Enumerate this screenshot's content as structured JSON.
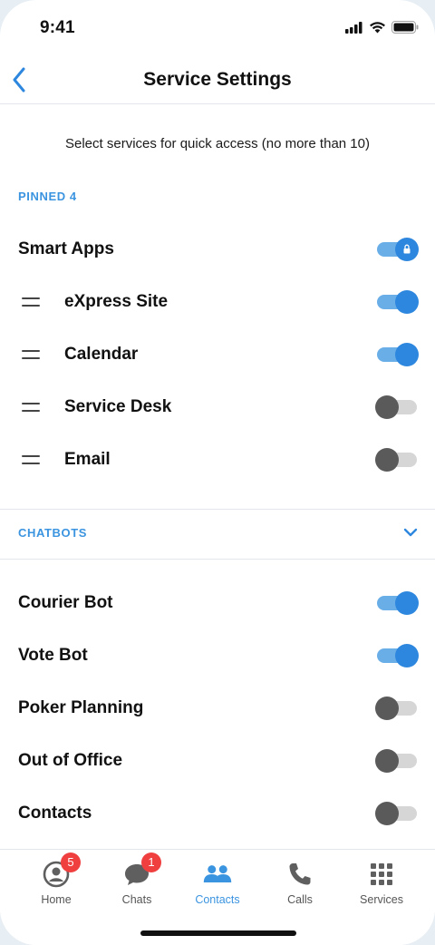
{
  "status": {
    "time": "9:41"
  },
  "nav": {
    "title": "Service Settings"
  },
  "subtitle": "Select services for quick access (no more than 10)",
  "pinned": {
    "section_label": "PINNED 4",
    "items": [
      {
        "label": "Smart Apps",
        "enabled": true,
        "locked": true,
        "draggable": false
      },
      {
        "label": "eXpress Site",
        "enabled": true,
        "locked": false,
        "draggable": true
      },
      {
        "label": "Calendar",
        "enabled": true,
        "locked": false,
        "draggable": true
      },
      {
        "label": "Service Desk",
        "enabled": false,
        "locked": false,
        "draggable": true
      },
      {
        "label": "Email",
        "enabled": false,
        "locked": false,
        "draggable": true
      }
    ]
  },
  "chatbots": {
    "section_label": "CHATBOTS",
    "items": [
      {
        "label": "Courier Bot",
        "enabled": true
      },
      {
        "label": "Vote Bot",
        "enabled": true
      },
      {
        "label": "Poker Planning",
        "enabled": false
      },
      {
        "label": "Out of Office",
        "enabled": false
      },
      {
        "label": "Contacts",
        "enabled": false
      }
    ]
  },
  "tabs": [
    {
      "label": "Home",
      "icon": "user-circle-icon",
      "badge": "5",
      "active": false
    },
    {
      "label": "Chats",
      "icon": "chat-bubble-icon",
      "badge": "1",
      "active": false
    },
    {
      "label": "Contacts",
      "icon": "people-icon",
      "badge": "",
      "active": true
    },
    {
      "label": "Calls",
      "icon": "phone-icon",
      "badge": "",
      "active": false
    },
    {
      "label": "Services",
      "icon": "grid-icon",
      "badge": "",
      "active": false
    }
  ],
  "colors": {
    "accent": "#2e87de",
    "accent_light": "#6aaee8",
    "section": "#3b94e0",
    "badge": "#ef3f3f"
  }
}
